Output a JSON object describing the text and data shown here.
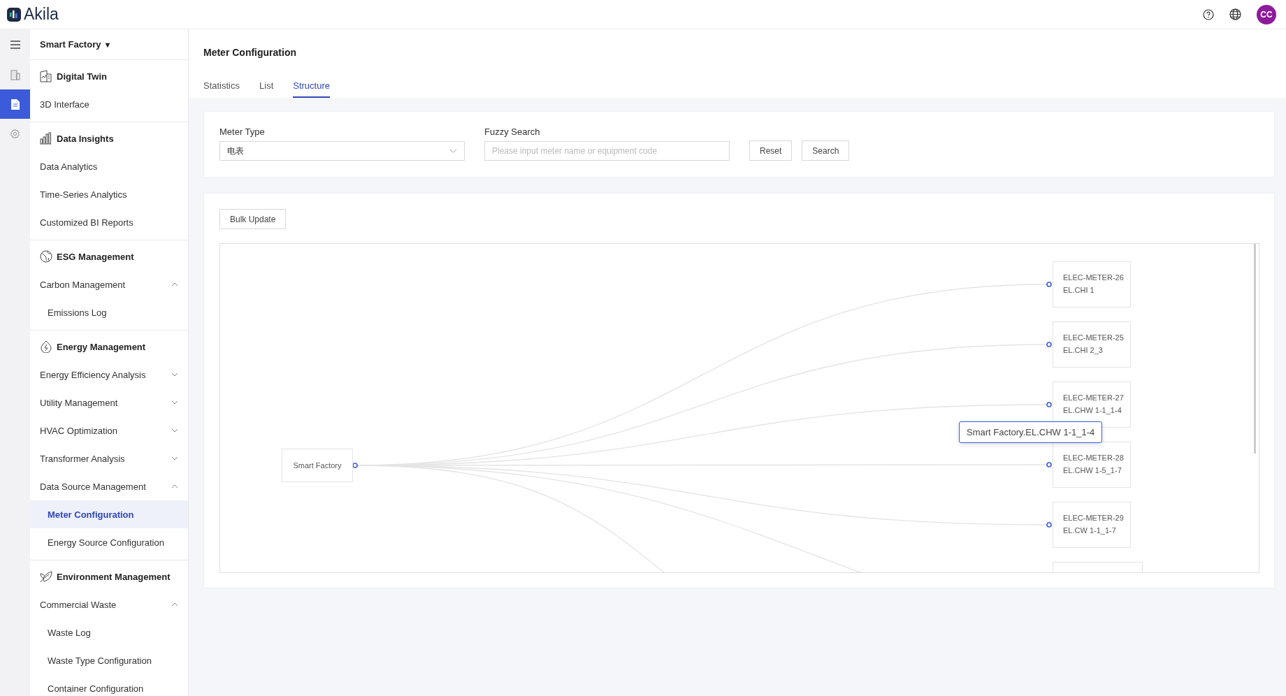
{
  "header": {
    "logo": "Akila",
    "avatar": "CC"
  },
  "rail": [
    {
      "kind": "menu",
      "selected": false
    },
    {
      "kind": "building",
      "selected": false
    },
    {
      "kind": "document",
      "selected": true
    },
    {
      "kind": "settings",
      "selected": false
    }
  ],
  "sidebar": {
    "org": "Smart Factory",
    "org_caret": "▼",
    "sections": [
      {
        "title": "Digital Twin",
        "kind": "twin",
        "items": [
          {
            "label": "3D Interface",
            "selected": false
          }
        ]
      },
      {
        "title": "Data Insights",
        "kind": "bars",
        "items": [
          {
            "label": "Data Analytics",
            "selected": false
          },
          {
            "label": "Time-Series Analytics",
            "selected": false
          },
          {
            "label": "Customized BI Reports",
            "selected": false
          }
        ]
      },
      {
        "title": "ESG Management",
        "kind": "globe",
        "items": [
          {
            "label": "Carbon Management",
            "selected": false,
            "expanded": true,
            "children": [
              {
                "label": "Emissions Log",
                "selected": false
              }
            ]
          }
        ]
      },
      {
        "title": "Energy Management",
        "kind": "bolt",
        "items": [
          {
            "label": "Energy Efficiency Analysis",
            "selected": false,
            "expanded": false
          },
          {
            "label": "Utility Management",
            "selected": false,
            "expanded": false
          },
          {
            "label": "HVAC Optimization",
            "selected": false,
            "expanded": false
          },
          {
            "label": "Transformer Analysis",
            "selected": false,
            "expanded": false
          },
          {
            "label": "Data Source Management",
            "selected": false,
            "expanded": true,
            "children": [
              {
                "label": "Meter Configuration",
                "selected": true
              },
              {
                "label": "Energy Source Configuration",
                "selected": false
              }
            ]
          }
        ]
      },
      {
        "title": "Environment Management",
        "kind": "leaf",
        "items": [
          {
            "label": "Commercial Waste",
            "selected": false,
            "expanded": true,
            "children": [
              {
                "label": "Waste Log",
                "selected": false
              },
              {
                "label": "Waste Type Configuration",
                "selected": false
              },
              {
                "label": "Container Configuration",
                "selected": false
              }
            ]
          }
        ]
      }
    ]
  },
  "page": {
    "title": "Meter Configuration",
    "tabs": [
      {
        "label": "Statistics",
        "selected": false
      },
      {
        "label": "List",
        "selected": false
      },
      {
        "label": "Structure",
        "selected": true
      }
    ]
  },
  "filters": {
    "meter_type": {
      "label": "Meter Type",
      "value": "电表"
    },
    "fuzzy_search": {
      "label": "Fuzzy Search",
      "placeholder": "Please input meter name or equipment code"
    },
    "buttons": [
      "Reset",
      "Search"
    ]
  },
  "structure": {
    "bulk_update": "Bulk Update",
    "root": "Smart Factory",
    "nodes": [
      {
        "code": "ELEC-METER-26",
        "name": "EL.CHI 1"
      },
      {
        "code": "ELEC-METER-25",
        "name": "EL.CHI 2_3"
      },
      {
        "code": "ELEC-METER-27",
        "name": "EL.CHW 1-1_1-4"
      },
      {
        "code": "ELEC-METER-28",
        "name": "EL.CHW 1-5_1-7"
      },
      {
        "code": "ELEC-METER-29",
        "name": "EL.CW 1-1_1-7"
      }
    ],
    "tooltip": "Smart Factory.EL.CHW 1-1_1-4"
  }
}
